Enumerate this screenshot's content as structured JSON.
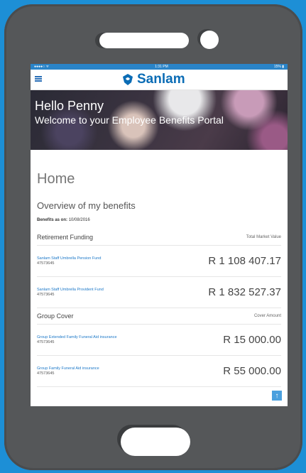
{
  "status": {
    "carrier": "●●●●○ ᯤ",
    "time": "1:31 PM",
    "battery": "15% ▮"
  },
  "header": {
    "brand": "Sanlam"
  },
  "hero": {
    "title": "Hello Penny",
    "subtitle": "Welcome to your Employee Benefits Portal"
  },
  "page": {
    "title": "Home",
    "overview": "Overview of my benefits",
    "benefits_as_on_label": "Benefits as on:",
    "benefits_as_on_value": "10/08/2016"
  },
  "sections": [
    {
      "title": "Retirement Funding",
      "right_label": "Total Market Value",
      "rows": [
        {
          "name": "Sanlam Staff Umbrella Pension Fund",
          "number": "47573645",
          "value": "R 1 108 407.17"
        },
        {
          "name": "Sanlam Staff Umbrella Provident Fund",
          "number": "47573645",
          "value": "R 1 832 527.37"
        }
      ]
    },
    {
      "title": "Group Cover",
      "right_label": "Cover Amount",
      "rows": [
        {
          "name": "Group Extended Family Funeral Aid insurance",
          "number": "47573645",
          "value": "R 15 000.00"
        },
        {
          "name": "Group Family Funeral Aid insurance",
          "number": "47573645",
          "value": "R 55 000.00"
        }
      ]
    }
  ],
  "colors": {
    "background": "#1d8fd6",
    "phone": "#555759",
    "brand": "#0b6cb5",
    "link": "#1c78c8"
  },
  "icons": {
    "menu": "hamburger-icon",
    "logo": "sanlam-shield-icon",
    "scroll": "arrow-up-icon"
  }
}
